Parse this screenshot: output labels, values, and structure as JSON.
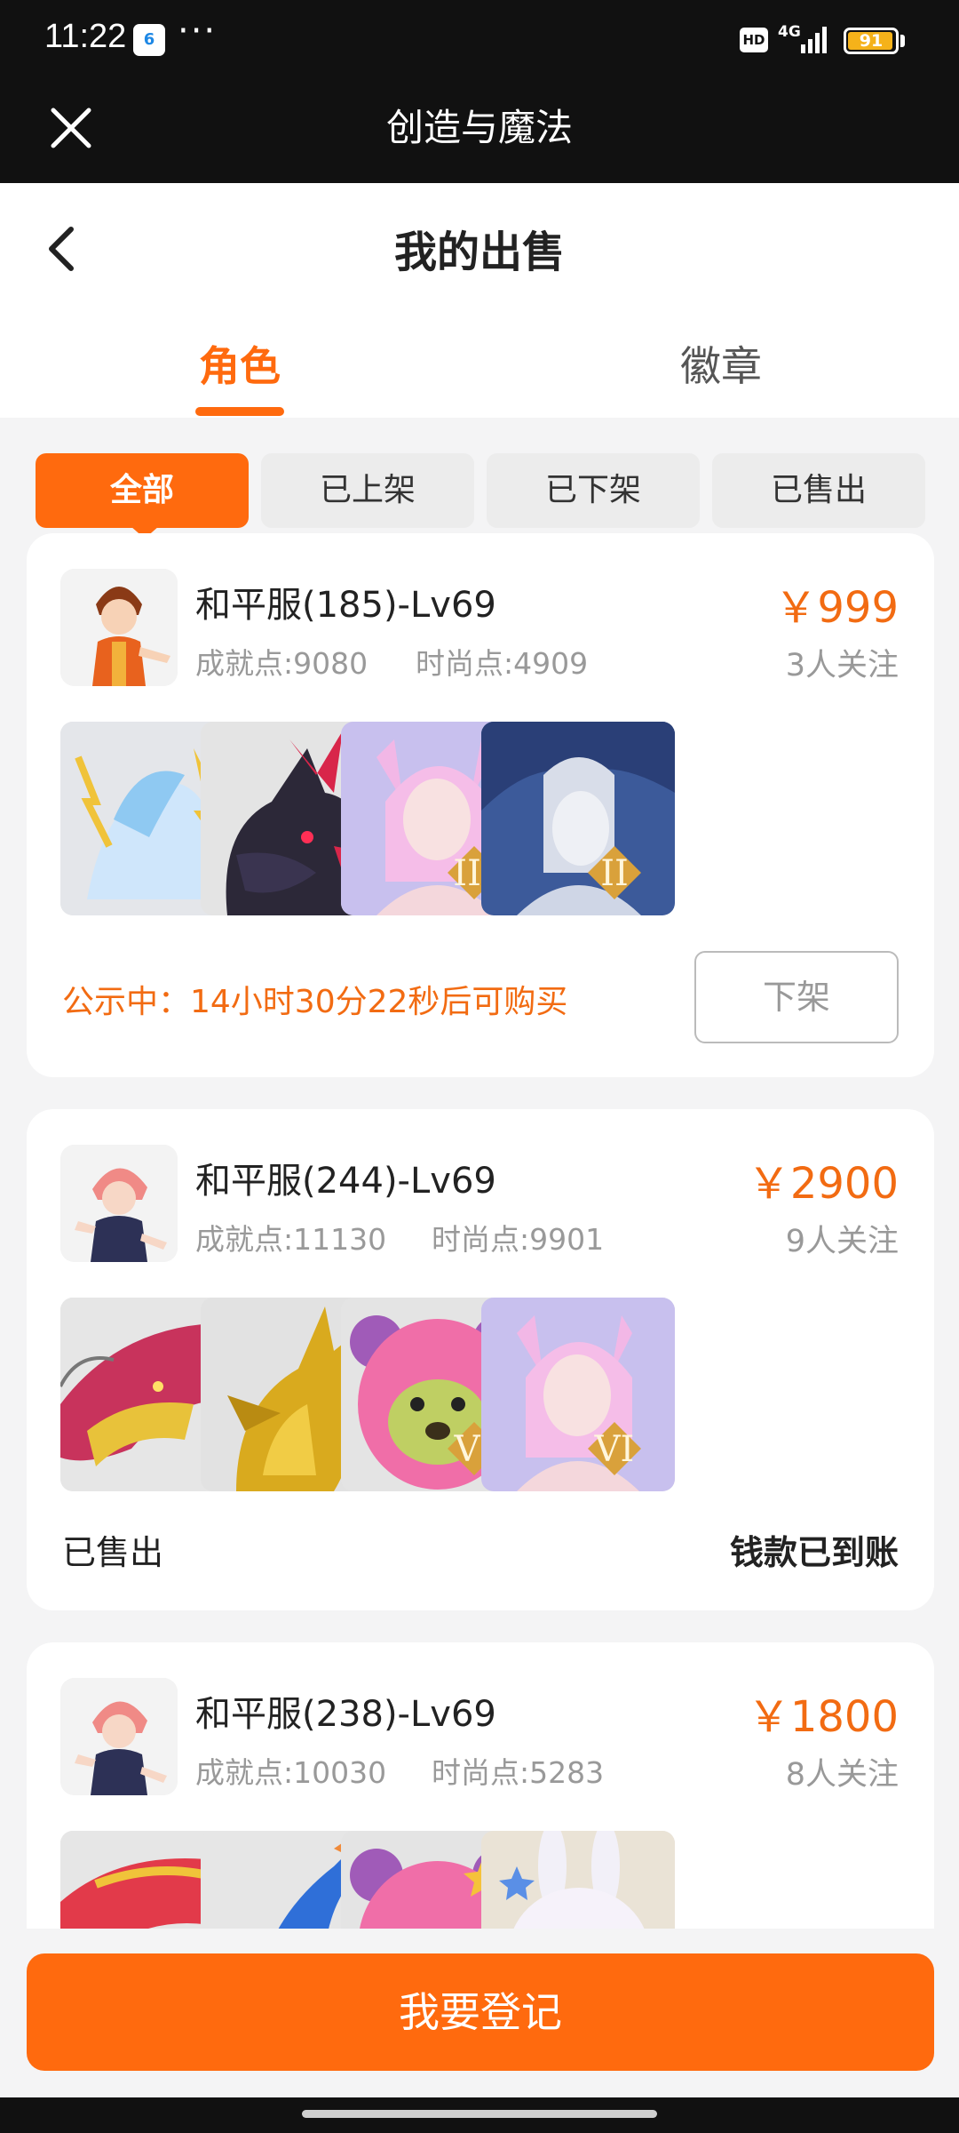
{
  "status_bar": {
    "time": "11:22",
    "notif_badge": "6",
    "dots": "···",
    "hd": "HD",
    "network": "4G",
    "battery": "91"
  },
  "app_bar": {
    "title": "创造与魔法"
  },
  "page": {
    "title": "我的出售"
  },
  "tabs": [
    {
      "label": "角色"
    },
    {
      "label": "徽章"
    }
  ],
  "filters": [
    {
      "label": "全部"
    },
    {
      "label": "已上架"
    },
    {
      "label": "已下架"
    },
    {
      "label": "已售出"
    }
  ],
  "listings": [
    {
      "name": "和平服(185)-Lv69",
      "achievement": "成就点:9080",
      "fashion": "时尚点:4909",
      "price": "￥999",
      "followers": "3人关注",
      "thumb_badges": [
        "",
        "",
        "III",
        "II"
      ],
      "notice": "公示中：14小时30分22秒后可购买",
      "action": "下架"
    },
    {
      "name": "和平服(244)-Lv69",
      "achievement": "成就点:11130",
      "fashion": "时尚点:9901",
      "price": "￥2900",
      "followers": "9人关注",
      "thumb_badges": [
        "",
        "",
        "VI",
        "VI"
      ],
      "status": "已售出",
      "payment": "钱款已到账"
    },
    {
      "name": "和平服(238)-Lv69",
      "achievement": "成就点:10030",
      "fashion": "时尚点:5283",
      "price": "￥1800",
      "followers": "8人关注",
      "thumb_badges": [
        "",
        "",
        "",
        ""
      ]
    }
  ],
  "bottom_button": {
    "label": "我要登记"
  },
  "colors": {
    "accent": "#ff6a0e",
    "price": "#f26b12",
    "header_bg": "#111111",
    "page_bg": "#f4f4f5"
  }
}
